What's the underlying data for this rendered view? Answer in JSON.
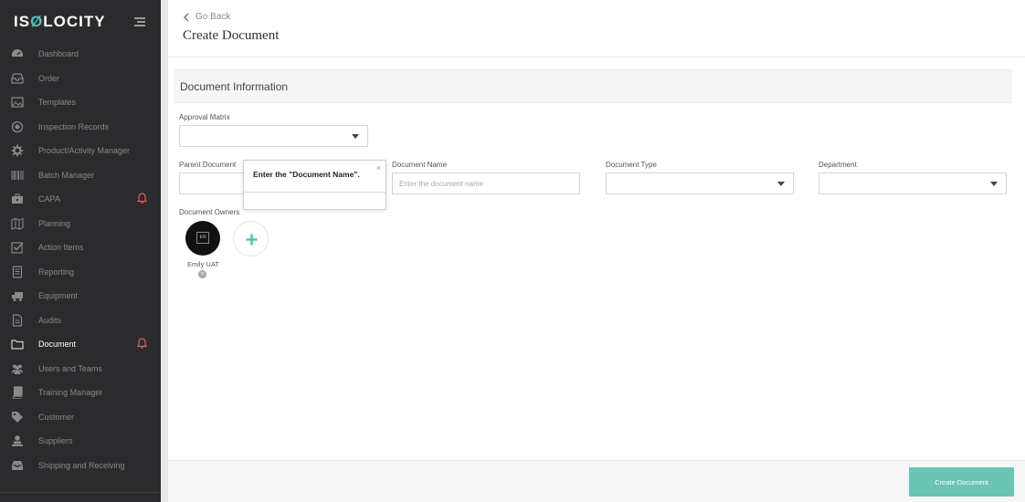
{
  "brand": {
    "logo_prefix": "IS",
    "logo_o": "Ø",
    "logo_suffix": "LOCITY"
  },
  "colors": {
    "sidebar_bg": "#2b2b2e",
    "accent": "#4fc3b4",
    "button": "#6cc4b6",
    "alert": "#e0605a"
  },
  "sidebar": {
    "items": [
      {
        "label": "Dashboard",
        "icon": "dashboard-icon"
      },
      {
        "label": "Order",
        "icon": "inbox-icon"
      },
      {
        "label": "Templates",
        "icon": "image-icon"
      },
      {
        "label": "Inspection Records",
        "icon": "target-icon"
      },
      {
        "label": "Product/Activity Manager",
        "icon": "gear-icon"
      },
      {
        "label": "Batch Manager",
        "icon": "barcode-icon"
      },
      {
        "label": "CAPA",
        "icon": "briefcase-icon"
      },
      {
        "label": "Planning",
        "icon": "map-icon"
      },
      {
        "label": "Action Items",
        "icon": "checkbox-icon"
      },
      {
        "label": "Reporting",
        "icon": "report-icon"
      },
      {
        "label": "Equipment",
        "icon": "truck-icon"
      },
      {
        "label": "Audits",
        "icon": "document-icon"
      },
      {
        "label": "Document",
        "icon": "folder-icon"
      },
      {
        "label": "Users and Teams",
        "icon": "users-icon"
      },
      {
        "label": "Training Manager",
        "icon": "book-icon"
      },
      {
        "label": "Customer",
        "icon": "tag-icon"
      },
      {
        "label": "Suppliers",
        "icon": "supplier-icon"
      },
      {
        "label": "Shipping and Receiving",
        "icon": "tray-icon"
      }
    ]
  },
  "header": {
    "back_label": "Go Back",
    "title": "Create Document"
  },
  "section": {
    "title": "Document Information"
  },
  "form": {
    "approval_matrix_label": "Approval Matrix",
    "parent_document_label": "Parent Document",
    "document_name_label": "Document Name",
    "document_name_placeholder": "Enter the document name",
    "document_type_label": "Document Type",
    "department_label": "Department",
    "document_owners_label": "Document Owners"
  },
  "popover": {
    "message": "Enter the \"Document Name\".",
    "close": "×"
  },
  "owners": [
    {
      "name": "Emily UAT",
      "initials": "EN"
    }
  ],
  "footer": {
    "create_label": "Create Document"
  }
}
